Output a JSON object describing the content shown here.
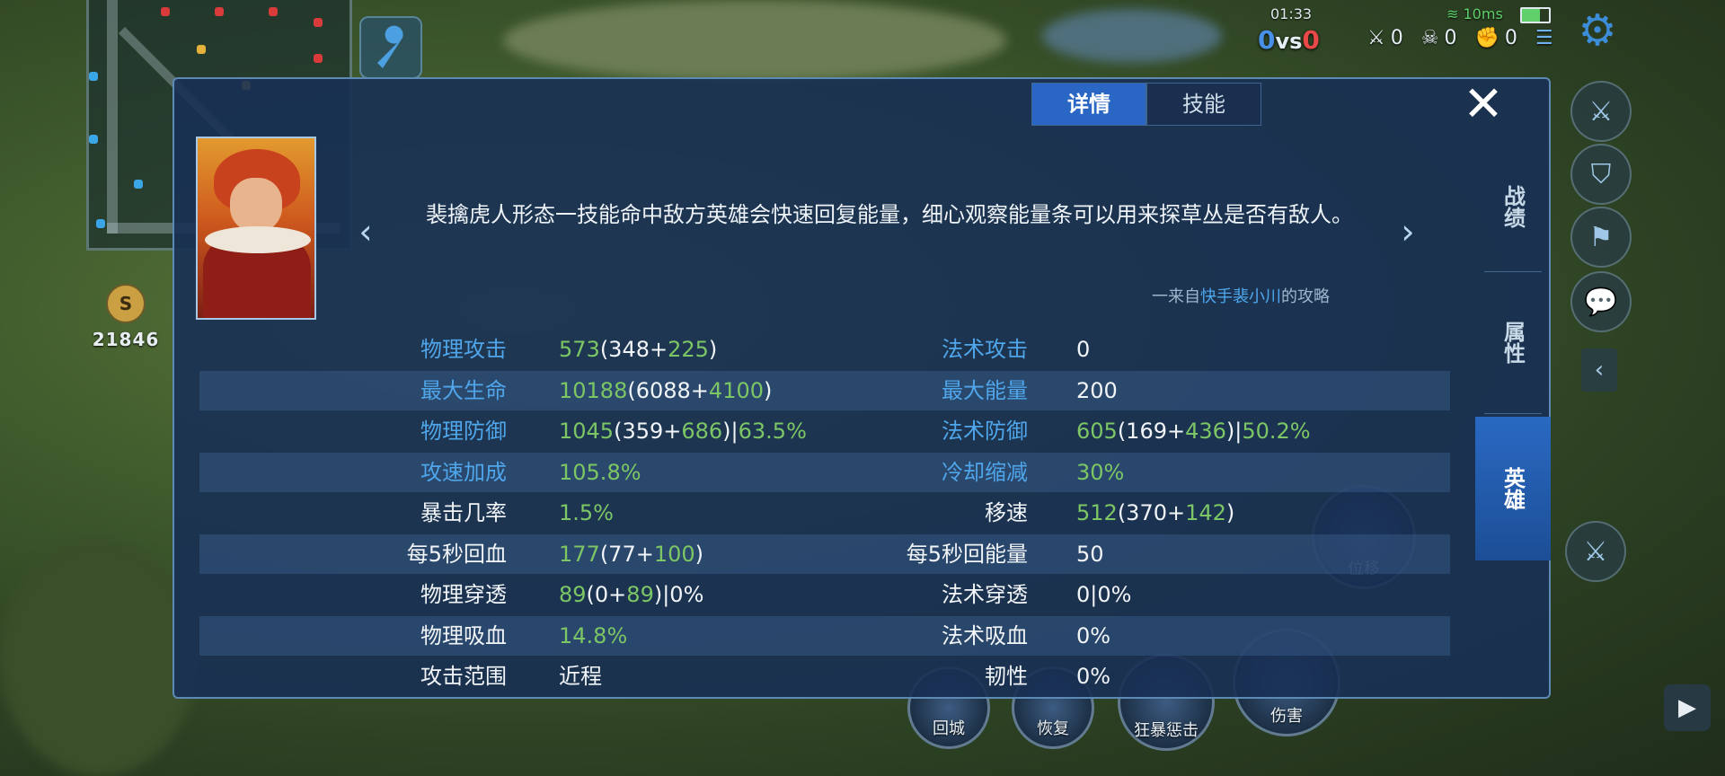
{
  "hud": {
    "timer": "01:33",
    "signal": "10ms",
    "score_blue": "0",
    "score_vs": "vs",
    "score_red": "0",
    "kills": "0",
    "deaths": "0",
    "assists": "0",
    "gold": "21846",
    "gold_icon_glyph": "S"
  },
  "tabs": {
    "details": "详情",
    "skills": "技能",
    "active": "details"
  },
  "side_tabs": {
    "record": "战绩",
    "attributes": "属性",
    "hero": "英雄",
    "active": "hero"
  },
  "tip": {
    "text": "裴擒虎人形态一技能命中敌方英雄会快速回复能量，细心观察能量条可以用来探草丛是否有敌人。",
    "source_prefix": "一来自",
    "source_author": "快手裴小川",
    "source_suffix": "的攻略"
  },
  "stats": [
    {
      "left": {
        "label": "物理攻击",
        "label_color": "blue",
        "parts": [
          [
            "573",
            "g"
          ],
          [
            "(348+",
            "w"
          ],
          [
            "225",
            "g"
          ],
          [
            ")",
            "w"
          ]
        ]
      },
      "right": {
        "label": "法术攻击",
        "label_color": "blue",
        "parts": [
          [
            "0",
            "w"
          ]
        ]
      }
    },
    {
      "left": {
        "label": "最大生命",
        "label_color": "blue",
        "parts": [
          [
            "10188",
            "g"
          ],
          [
            "(6088+",
            "w"
          ],
          [
            "4100",
            "g"
          ],
          [
            ")",
            "w"
          ]
        ]
      },
      "right": {
        "label": "最大能量",
        "label_color": "blue",
        "parts": [
          [
            "200",
            "w"
          ]
        ]
      }
    },
    {
      "left": {
        "label": "物理防御",
        "label_color": "blue",
        "parts": [
          [
            "1045",
            "g"
          ],
          [
            "(359+",
            "w"
          ],
          [
            "686",
            "g"
          ],
          [
            ")|",
            "w"
          ],
          [
            "63.5%",
            "g"
          ]
        ]
      },
      "right": {
        "label": "法术防御",
        "label_color": "blue",
        "parts": [
          [
            "605",
            "g"
          ],
          [
            "(169+",
            "w"
          ],
          [
            "436",
            "g"
          ],
          [
            ")|",
            "w"
          ],
          [
            "50.2%",
            "g"
          ]
        ]
      }
    },
    {
      "left": {
        "label": "攻速加成",
        "label_color": "blue",
        "parts": [
          [
            "105.8%",
            "g"
          ]
        ]
      },
      "right": {
        "label": "冷却缩减",
        "label_color": "blue",
        "parts": [
          [
            "30%",
            "g"
          ]
        ]
      }
    },
    {
      "left": {
        "label": "暴击几率",
        "label_color": "white",
        "parts": [
          [
            "1.5%",
            "g"
          ]
        ]
      },
      "right": {
        "label": "移速",
        "label_color": "white",
        "parts": [
          [
            "512",
            "g"
          ],
          [
            "(370+",
            "w"
          ],
          [
            "142",
            "g"
          ],
          [
            ")",
            "w"
          ]
        ]
      }
    },
    {
      "left": {
        "label": "每5秒回血",
        "label_color": "white",
        "parts": [
          [
            "177",
            "g"
          ],
          [
            "(77+",
            "w"
          ],
          [
            "100",
            "g"
          ],
          [
            ")",
            "w"
          ]
        ]
      },
      "right": {
        "label": "每5秒回能量",
        "label_color": "white",
        "parts": [
          [
            "50",
            "w"
          ]
        ]
      }
    },
    {
      "left": {
        "label": "物理穿透",
        "label_color": "white",
        "parts": [
          [
            "89",
            "g"
          ],
          [
            "(0+",
            "w"
          ],
          [
            "89",
            "g"
          ],
          [
            ")|0%",
            "w"
          ]
        ]
      },
      "right": {
        "label": "法术穿透",
        "label_color": "white",
        "parts": [
          [
            "0|0%",
            "w"
          ]
        ]
      }
    },
    {
      "left": {
        "label": "物理吸血",
        "label_color": "white",
        "parts": [
          [
            "14.8%",
            "g"
          ]
        ]
      },
      "right": {
        "label": "法术吸血",
        "label_color": "white",
        "parts": [
          [
            "0%",
            "w"
          ]
        ]
      }
    },
    {
      "left": {
        "label": "攻击范围",
        "label_color": "white",
        "parts": [
          [
            "近程",
            "w"
          ]
        ]
      },
      "right": {
        "label": "韧性",
        "label_color": "white",
        "parts": [
          [
            "0%",
            "w"
          ]
        ]
      }
    }
  ],
  "skills": {
    "recall": "回城",
    "heal": "恢复",
    "spell": "狂暴惩击",
    "damage": "伤害",
    "flash": "位移"
  },
  "colors": {
    "label_blue": "#4fa6ea",
    "value_green": "#7cc665",
    "panel": "#183054",
    "tab_active": "#2a66c4"
  }
}
